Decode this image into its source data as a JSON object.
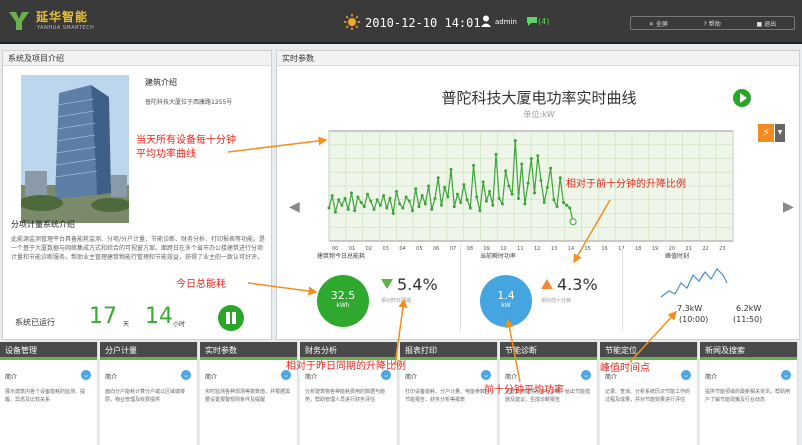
{
  "header": {
    "brand": "延华智能",
    "brand_sub": "YANHUA SMARTECH",
    "datetime": "2010-12-10 14:01",
    "user": "admin",
    "messages": "(4)",
    "buttons": [
      "✕ 全屏",
      "? 帮助",
      "■ 退出"
    ]
  },
  "left_panel": {
    "title": "系统及项目介绍",
    "building_title": "建筑介绍",
    "building_address": "普陀科技大厦位于西康路1255号",
    "system_title": "分项计量系统介绍",
    "system_desc": "此能源监测管理平台具备能耗监测、分项/分户计量、节能诊断、财务分析、打印报表等功能。是一个基于大厦数据与网络集成方式和综合的可视窗方案。面跨日在多个省市办公楼建筑进行分项计量和节能诊断服务。帮助业主管理建筑物能行管理和节能效益，获得了业主的一致认可好评。",
    "running_label": "系统已运行",
    "days": "17",
    "days_unit": "天",
    "hours": "14",
    "hours_unit": "小时"
  },
  "right_panel": {
    "title": "实时参数",
    "chart_title": "普陀科技大厦电功率实时曲线",
    "chart_unit": "单位:kW",
    "m1_title": "建筑物今日总能耗",
    "m1_value": "32.5",
    "m1_unit": "kWh",
    "m1_pct": "5.4%",
    "m1_caption": "相对昨日同期",
    "m2_title": "当前瞬时功率",
    "m2_value": "1.4",
    "m2_unit": "kW",
    "m2_pct": "4.3%",
    "m2_caption": "相对前十分钟",
    "m3_title": "峰值时刻",
    "peak1_value": "7.3kW",
    "peak1_time": "(10:00)",
    "peak2_value": "6.2kW",
    "peak2_time": "(11:50)"
  },
  "chart_data": {
    "type": "line",
    "title": "普陀科技大厦电功率实时曲线",
    "ylabel": "单位:kW",
    "x_ticks": [
      "00",
      "01",
      "02",
      "03",
      "04",
      "05",
      "06",
      "07",
      "08",
      "09",
      "10",
      "11",
      "12",
      "13",
      "14",
      "15",
      "16",
      "17",
      "18",
      "19",
      "20",
      "21",
      "22",
      "23"
    ],
    "series": [
      {
        "values": [
          2.4,
          3.3,
          2.1,
          3.0,
          2.6,
          3.1,
          2.3,
          3.5,
          2.2,
          3.2,
          2.8,
          2.5,
          3.4,
          2.9,
          2.3,
          3.0,
          2.6,
          3.3,
          2.4,
          3.1,
          2.0,
          3.6,
          2.7,
          2.4,
          3.2,
          2.9,
          2.2,
          3.8,
          2.5,
          3.3,
          2.7,
          4.0,
          2.3,
          3.1,
          4.6,
          2.6,
          3.9,
          3.2,
          5.2,
          2.5,
          3.4,
          2.8,
          4.1,
          3.0,
          2.4,
          5.5,
          3.2,
          2.2,
          4.3,
          2.9,
          3.6,
          2.6,
          6.3,
          3.1,
          2.7,
          5.1,
          4.0,
          3.4,
          7.3,
          3.1,
          5.6,
          2.7,
          4.2,
          6.0,
          3.5,
          6.2,
          4.4,
          2.8,
          3.9,
          5.3,
          3.0,
          2.5,
          4.6,
          2.8,
          2.6,
          2.4,
          1.4
        ]
      }
    ],
    "ylim": [
      0,
      8
    ]
  },
  "bottom_nav": [
    {
      "title": "设备管理",
      "intro": "简介",
      "text": "展示建筑内各个设备能耗的监测、提醒、异态及比较关系"
    },
    {
      "title": "分户计量",
      "intro": "简介",
      "text": "面向分户能耗计算分户或以区域或楼层，物业管理及收费提供"
    },
    {
      "title": "实时参数",
      "intro": "简介",
      "text": "实时监测各种现场等数数值，并根据需要设置报警规则条件及提醒"
    },
    {
      "title": "财务分析",
      "intro": "简介",
      "text": "分析建筑物各种能耗费用的数据与趋势，帮助管理人员进行财务评估"
    },
    {
      "title": "报表打印",
      "intro": "简介",
      "text": "打印设备能耗、分户计量、电能参数、节能报告，财务分析等报表"
    },
    {
      "title": "节能诊断",
      "intro": "简介",
      "text": "对建筑用能情况进行诊断，给出节能措施及建议，生成诊断报告"
    },
    {
      "title": "节能定位",
      "intro": "简介",
      "text": "记录、查询、分析系统历次节能工作的过程及成果，并对节能效果进行评估"
    },
    {
      "title": "新闻及搜索",
      "intro": "简介",
      "text": "提供节能领域的最新相关资讯，帮助用户了解节能政策及行业动态"
    }
  ],
  "annotations": {
    "a1": "当天所有设备每十分钟平均功率曲线",
    "a2": "相对于前十分钟的升降比例",
    "a3": "今日总能耗",
    "a4": "相对于昨日同期的升降比例",
    "a5": "前十分钟平均功率",
    "a6": "峰值时间点"
  },
  "colors": {
    "accent_green": "#2ea82e",
    "accent_blue": "#45a5e0",
    "annotation_red": "#e8271d",
    "arrow_orange": "#f0901e"
  }
}
